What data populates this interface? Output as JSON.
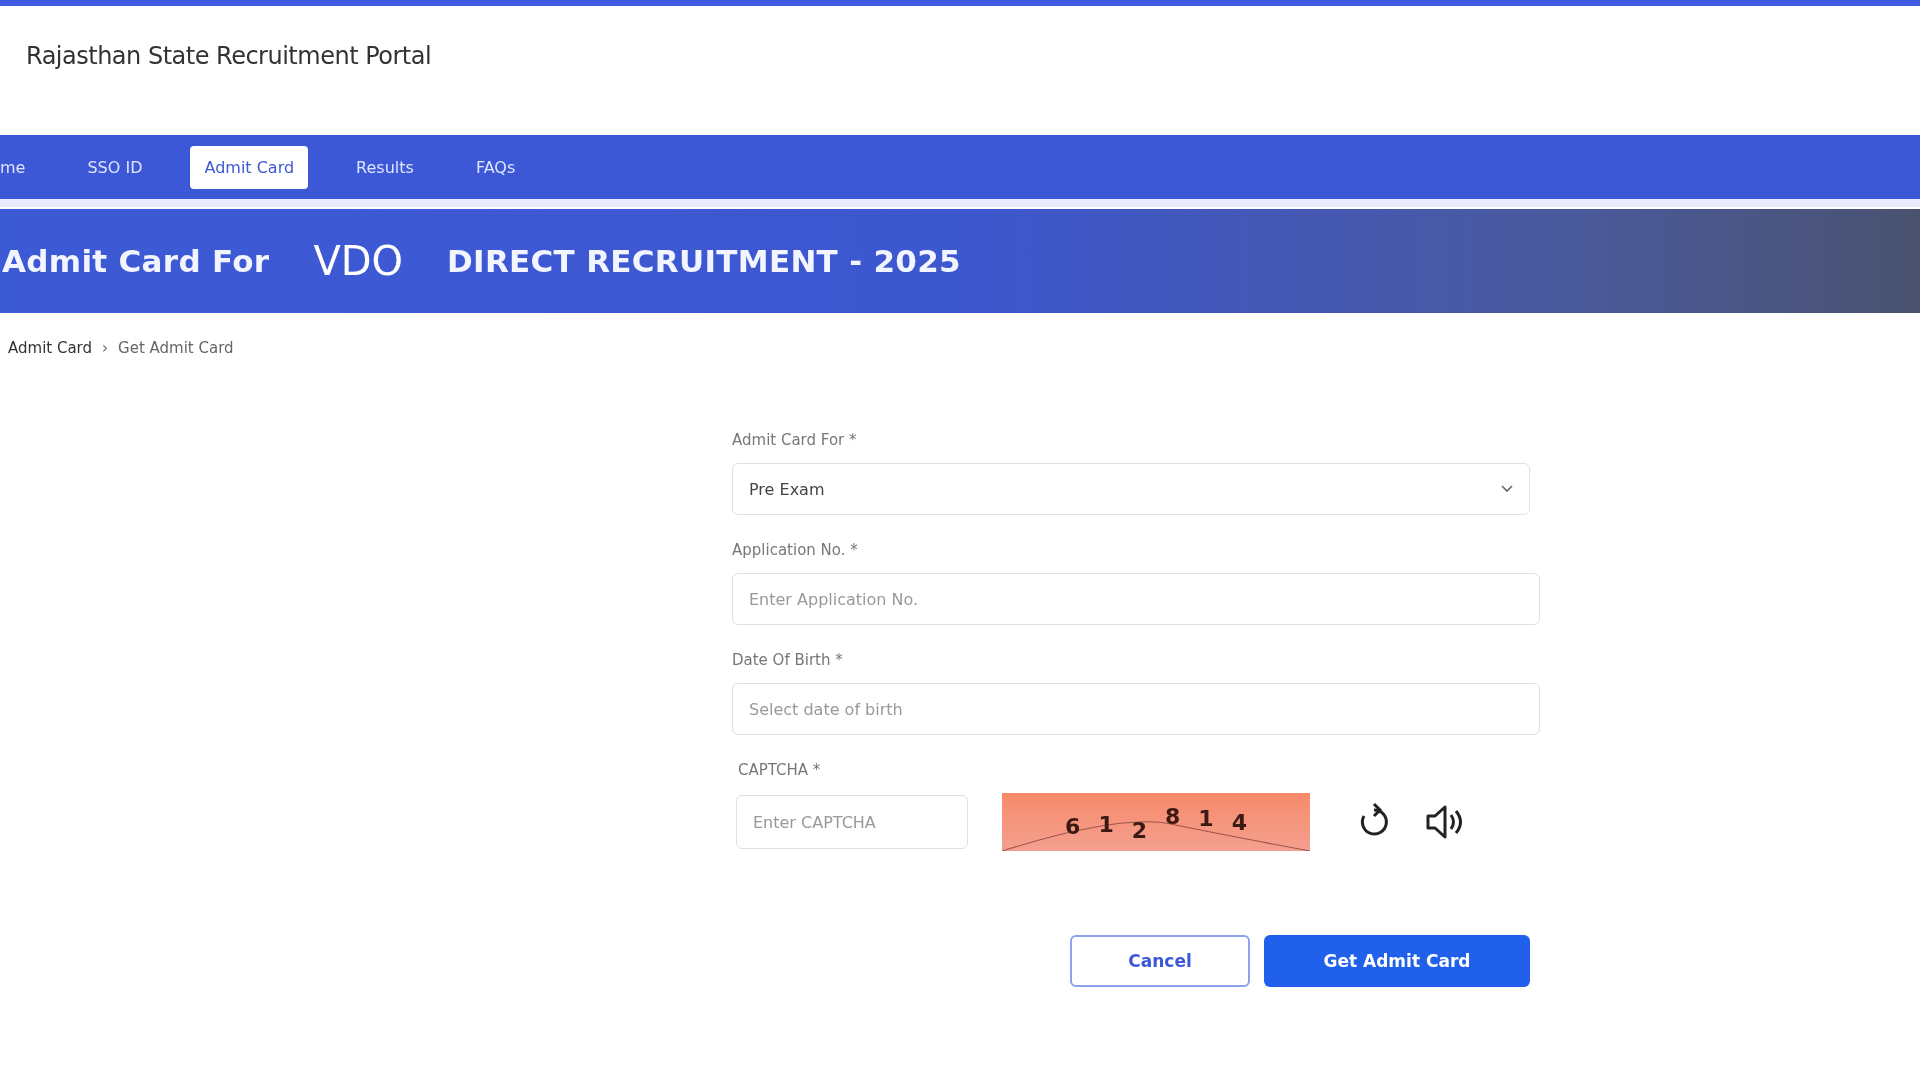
{
  "header": {
    "title": "Rajasthan State Recruitment Portal"
  },
  "nav": [
    {
      "label": "me",
      "selected": false
    },
    {
      "label": "SSO ID",
      "selected": false
    },
    {
      "label": "Admit Card",
      "selected": true
    },
    {
      "label": "Results",
      "selected": false
    },
    {
      "label": "FAQs",
      "selected": false
    }
  ],
  "banner": {
    "prefix": "Admit Card For",
    "post": "VDO",
    "recruitment": "DIRECT RECRUITMENT - 2025"
  },
  "breadcrumb": {
    "separator": "›",
    "items": [
      "Admit Card",
      "Get Admit Card"
    ]
  },
  "form": {
    "fields": [
      {
        "kind": "select",
        "label": "Admit Card For *",
        "value": "Pre Exam"
      },
      {
        "kind": "text",
        "label": "Application No. *",
        "placeholder": "Enter Application No."
      },
      {
        "kind": "text",
        "label": "Date Of Birth *",
        "placeholder": "Select date of birth"
      }
    ],
    "captcha": {
      "label": "CAPTCHA *",
      "placeholder": "Enter CAPTCHA",
      "chars": [
        "6",
        "1",
        "2",
        "8",
        "1",
        "4"
      ]
    },
    "buttons": [
      {
        "kind": "secondary",
        "label": "Cancel"
      },
      {
        "kind": "primary",
        "label": "Get Admit Card"
      }
    ]
  }
}
